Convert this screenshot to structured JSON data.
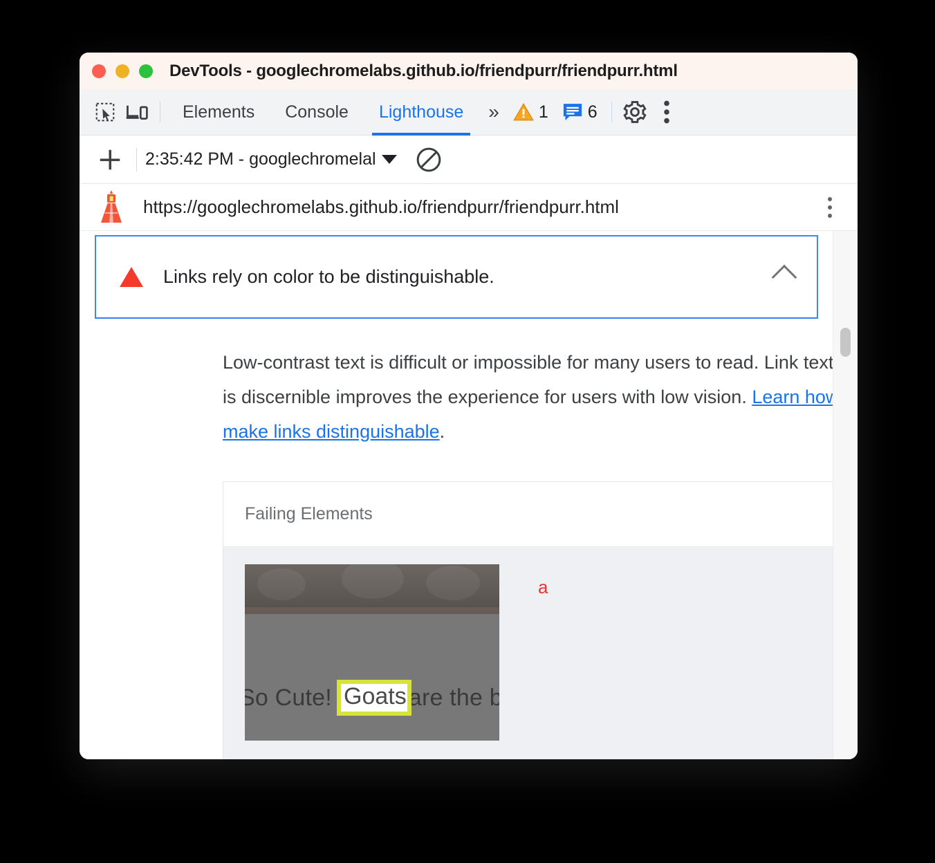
{
  "window": {
    "title": "DevTools - googlechromelabs.github.io/friendpurr/friendpurr.html",
    "traffic_lights": [
      "close",
      "minimize",
      "maximize"
    ],
    "colors": {
      "titlebar_bg": "#fdf3ef",
      "accent_blue": "#1a73e8",
      "fail_red": "#f5392a",
      "warn_orange": "#f5a623"
    }
  },
  "tabstrip": {
    "inspect_icon": "inspect-element-icon",
    "device_icon": "device-toolbar-icon",
    "tabs": [
      {
        "label": "Elements",
        "active": false
      },
      {
        "label": "Console",
        "active": false
      },
      {
        "label": "Lighthouse",
        "active": true
      }
    ],
    "overflow_label": "»",
    "warning_count": "1",
    "message_count": "6",
    "settings_icon": "gear-icon",
    "more_icon": "kebab-menu-icon"
  },
  "subbar": {
    "new_audit_label": "+",
    "run_selected": "2:35:42 PM - googlechromelal",
    "clear_icon": "clear-all-icon"
  },
  "urlrow": {
    "lighthouse_icon": "lighthouse-icon",
    "url": "https://googlechromelabs.github.io/friendpurr/friendpurr.html",
    "menu_icon": "kebab-menu-icon"
  },
  "audit": {
    "status_icon": "fail-triangle-icon",
    "title": "Links rely on color to be distinguishable.",
    "collapse_icon": "chevron-up-icon",
    "description_before": "Low-contrast text is difficult or impossible for many users to read. Link text that is discernible improves the experience for users with low vision. ",
    "description_link": "Learn how to make links distinguishable",
    "description_after": "."
  },
  "failing_table": {
    "header": "Failing Elements",
    "rows": [
      {
        "thumbnail_text": "So Cute! Goats are the b",
        "highlighted_text": "Goats",
        "highlight_color": "#d7e23c",
        "selector": "a"
      }
    ]
  },
  "scrollbar": {
    "thumb_position": "near-top"
  }
}
